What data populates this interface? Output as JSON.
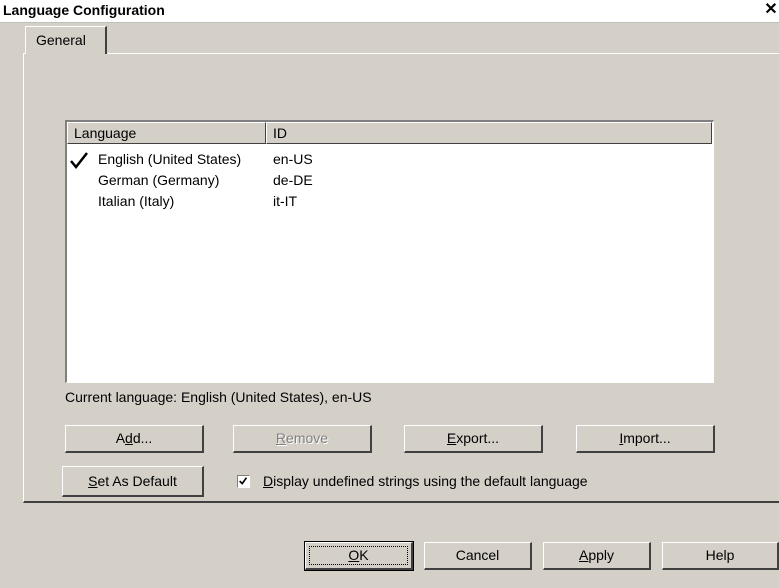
{
  "window": {
    "title": "Language Configuration",
    "close_glyph": "✕"
  },
  "tabs": [
    {
      "label": "General",
      "selected": true
    }
  ],
  "list": {
    "columns": [
      "Language",
      "ID"
    ],
    "rows": [
      {
        "language": "English (United States)",
        "id": "en-US",
        "checked": true
      },
      {
        "language": "German (Germany)",
        "id": "de-DE",
        "checked": false
      },
      {
        "language": "Italian (Italy)",
        "id": "it-IT",
        "checked": false
      }
    ]
  },
  "current_language_text": "Current language: English (United States), en-US",
  "buttons": {
    "add": {
      "pre": "A",
      "key": "d",
      "post": "d..."
    },
    "remove": {
      "pre": "",
      "key": "R",
      "post": "emove"
    },
    "export": {
      "pre": "",
      "key": "E",
      "post": "xport..."
    },
    "import": {
      "pre": "",
      "key": "I",
      "post": "mport..."
    },
    "set_default": {
      "pre": "",
      "key": "S",
      "post": "et As Default"
    },
    "ok": {
      "pre": "",
      "key": "O",
      "post": "K"
    },
    "cancel": {
      "label": "Cancel"
    },
    "apply": {
      "pre": "",
      "key": "A",
      "post": "pply"
    },
    "help": {
      "label": "Help"
    }
  },
  "display_undefined": {
    "checked": true,
    "pre": "",
    "key": "D",
    "post": "isplay undefined strings using the default language"
  },
  "colors": {
    "face": "#d4d0c8",
    "shadow": "#808080",
    "dark_shadow": "#404040",
    "highlight": "#ffffff"
  }
}
